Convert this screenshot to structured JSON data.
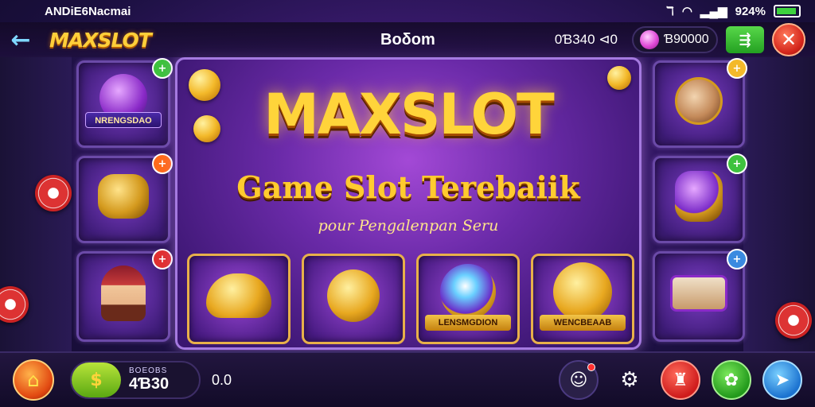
{
  "status_bar": {
    "carrier": "ANDiE6Nacmai",
    "battery": "924%",
    "battery_level": 0.92
  },
  "top_bar": {
    "logo": "MAXSLOT",
    "title": "Boδom",
    "credit": "0Ɓ340 ⊲0",
    "gems": "Ɓ90000",
    "action_icon": "fast-forward-icon",
    "close_icon": "close-icon"
  },
  "hero": {
    "title": "MAXSLOT",
    "subtitle": "Game Slot Terebaiik",
    "tagline": "pour Pengalenpan Seru"
  },
  "left_tiles": [
    {
      "banner": "NRENGSDAO",
      "badge_color": "#3ec23e",
      "icon": "potion-icon"
    },
    {
      "banner": "",
      "badge_color": "#ff6a1a",
      "icon": "bell-icon"
    },
    {
      "banner": "",
      "badge_color": "#e03030",
      "icon": "character-icon"
    }
  ],
  "right_tiles": [
    {
      "banner": "",
      "badge_color": "#f3b92a",
      "icon": "creature-icon"
    },
    {
      "banner": "",
      "badge_color": "#3ec23e",
      "icon": "vase-icon"
    },
    {
      "banner": "",
      "badge_color": "#3a8ae0",
      "icon": "scroll-icon"
    }
  ],
  "game_cards": [
    {
      "banner": "",
      "icon": "golden-lamp-icon"
    },
    {
      "banner": "",
      "icon": "golden-key-icon"
    },
    {
      "banner": "LENSMGDION",
      "icon": "crystal-orb-icon"
    },
    {
      "banner": "WENCBEAAB",
      "icon": "golden-shield-icon"
    }
  ],
  "bottom_bar": {
    "balance_label": "BOEOBS",
    "balance_value": "4Ɓ30",
    "extra_value": "0.0",
    "home_icon": "home-icon",
    "balance_icon": "coin-stack-icon",
    "buttons": [
      "profile-icon",
      "settings-icon",
      "alert-icon",
      "settings-gear-icon",
      "send-icon"
    ]
  },
  "colors": {
    "accent_gold": "#ffd43a",
    "panel_purple": "#6a2aa8",
    "frame_border": "#a57ae0"
  }
}
